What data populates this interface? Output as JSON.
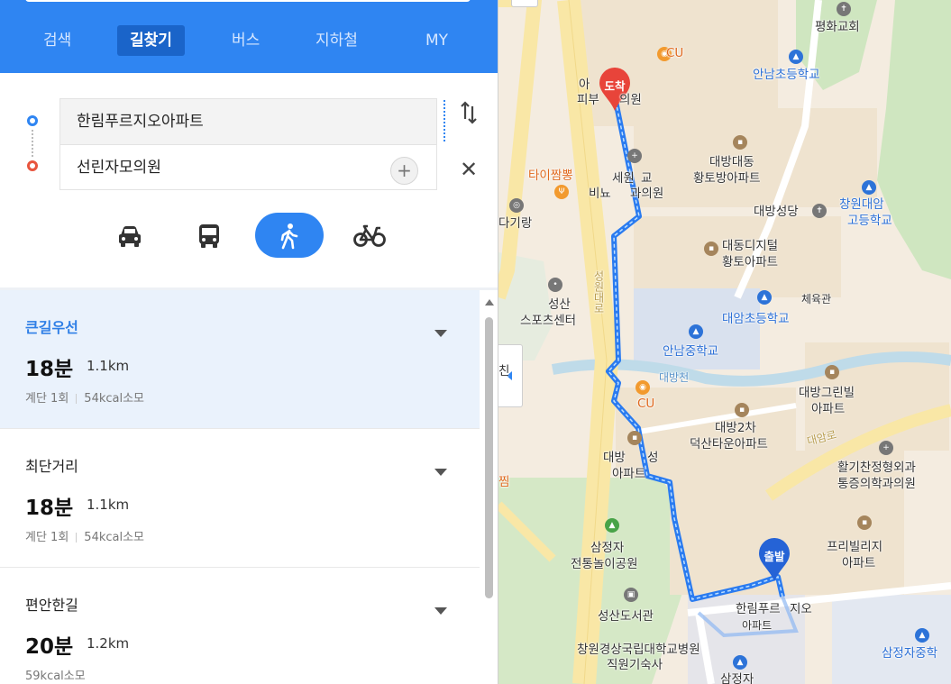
{
  "tabs": [
    "검색",
    "길찾기",
    "버스",
    "지하철",
    "MY"
  ],
  "active_tab": "길찾기",
  "route_inputs": {
    "start": "한림푸르지오아파트",
    "end": "선린자모의원"
  },
  "icons": {
    "add": "+",
    "swap": "⇅",
    "close": "✕"
  },
  "transport_modes": [
    "car-icon",
    "bus-icon",
    "walk-icon",
    "bicycle-icon"
  ],
  "active_mode": "walk",
  "results": [
    {
      "title": "큰길우선",
      "time": "18분",
      "distance": "1.1km",
      "stairs": "계단 1회",
      "kcal": "54kcal소모",
      "selected": true
    },
    {
      "title": "최단거리",
      "time": "18분",
      "distance": "1.1km",
      "stairs": "계단 1회",
      "kcal": "54kcal소모",
      "selected": false
    },
    {
      "title": "편안한길",
      "time": "20분",
      "distance": "1.2km",
      "stairs": "",
      "kcal": "59kcal소모",
      "selected": false
    }
  ],
  "map": {
    "markers": {
      "start": "출발",
      "end": "도착"
    },
    "labels": {
      "pyeonghwa_church": "평화교회",
      "cu_top": "CU",
      "annam_elem": "안남초등학교",
      "a_label": "아",
      "skin_clinic": "피부",
      "clinic_tail": "의원",
      "daebang_daedong": "대방대동",
      "hwangto_apt": "황토방아파트",
      "taijjamppong": "타이짬뽕",
      "sewon": "세원",
      "gyo": "교",
      "binyo": "비뇨",
      "gwa_clinic": "과의원",
      "daebang_cathedral": "대방성당",
      "changwon_daeam": "창원대암",
      "high_school": "고등학교",
      "dagirang": "다기랑",
      "daedong_digital": "대동디지털",
      "hwangto_apt2": "황토아파트",
      "gym": "체육관",
      "seongsan": "성산",
      "sports_center": "스포츠센터",
      "road_seongwon": "성원대로",
      "daeam_elem": "대암초등학교",
      "annam_middle": "안남중학교",
      "daebangcheon": "대방천",
      "chin": "친",
      "cu_mid": "CU",
      "daebang_green": "대방그린빌",
      "apt": "아파트",
      "daebang_2cha": "대방2차",
      "deoksan_town": "덕산타운아파트",
      "daeam_ro": "대암로",
      "daebang_seong": "대방",
      "seong": "성",
      "apt2": "아파트",
      "jjim": "찜",
      "hwalgichan": "활기찬정형외과",
      "tongjeung": "통증의학과의원",
      "samjeongja": "삼정자",
      "folk_park": "전통놀이공원",
      "freeville": "프리빌리지",
      "apt3": "아파트",
      "library": "성산도서관",
      "hanlim": "한림푸르",
      "jio": "지오",
      "apt4": "아파트",
      "samjeongja_middle": "삼정자중학",
      "gyeongsang": "창원경상국립대학교병원",
      "dorm": "직원기숙사",
      "samjeongja_bottom": "삼정자"
    }
  }
}
